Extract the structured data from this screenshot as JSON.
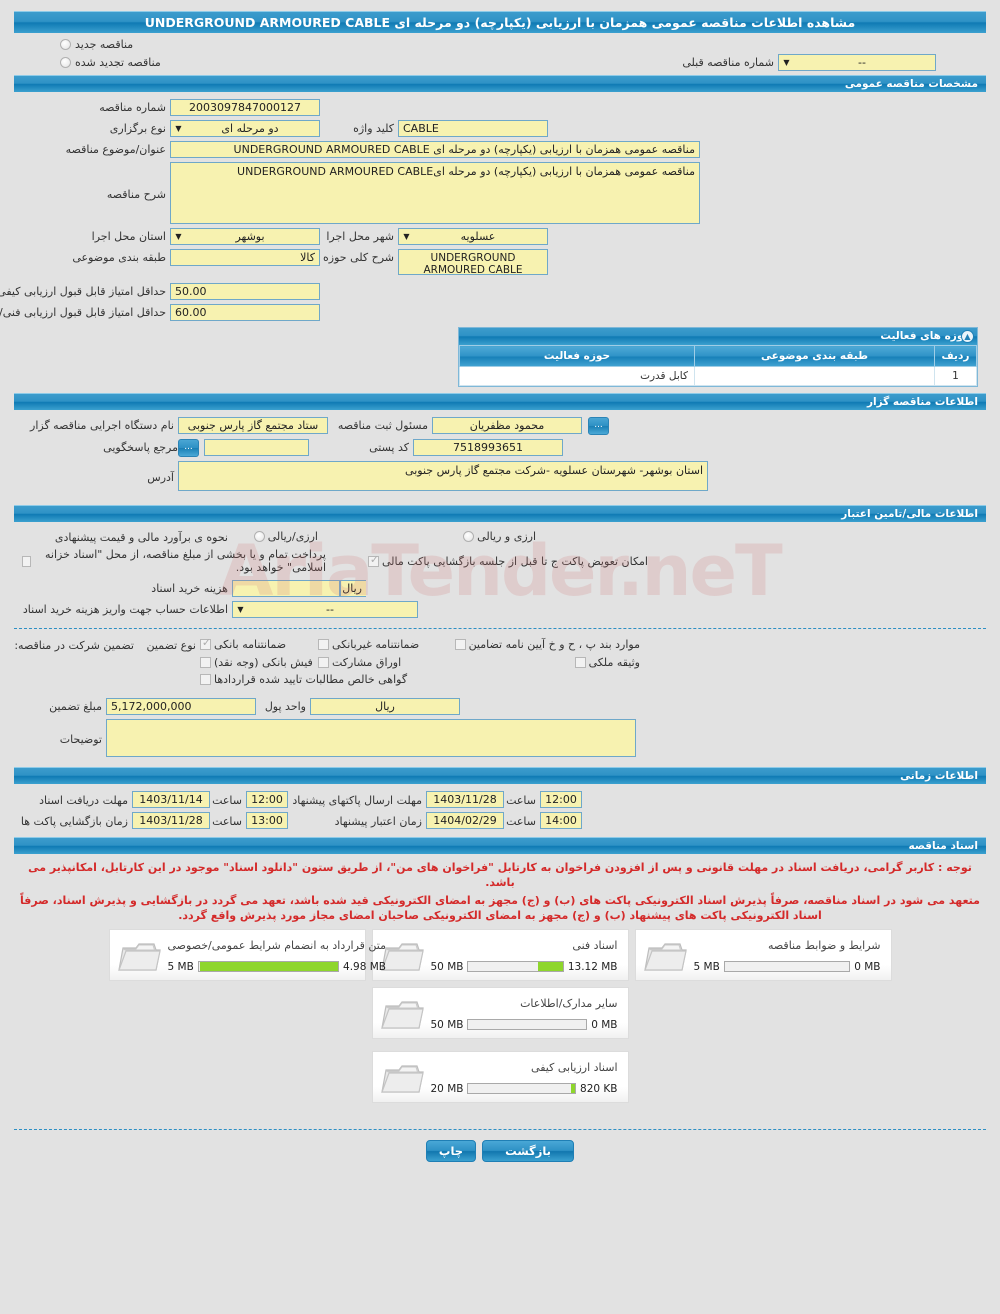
{
  "page": {
    "title": "مشاهده اطلاعات مناقصه عمومی همزمان با ارزیابی (یکپارچه) دو مرحله ای UNDERGROUND ARMOURED CABLE"
  },
  "top": {
    "new_tender_label": "مناقصه جدید",
    "renewed_tender_label": "مناقصه تجدید شده",
    "prev_tender_number_label": "شماره مناقصه قبلی",
    "prev_tender_number_value": "--"
  },
  "general": {
    "section_title": "مشخصات مناقصه عمومی",
    "tender_no_label": "شماره مناقصه",
    "tender_no_value": "2003097847000127",
    "holding_type_label": "نوع برگزاری",
    "holding_type_value": "دو مرحله ای",
    "keyword_label": "کلید واژه",
    "keyword_value": "CABLE",
    "subject_label": "عنوان/موضوع مناقصه",
    "subject_value": "مناقصه عمومی همزمان با ارزیابی (یکپارچه) دو مرحله ای UNDERGROUND ARMOURED CABLE",
    "description_label": "شرح مناقصه",
    "description_value": "مناقصه عمومی همزمان با ارزیابی (یکپارچه) دو مرحله ایUNDERGROUND ARMOURED CABLE",
    "province_label": "استان محل اجرا",
    "province_value": "بوشهر",
    "city_label": "شهر محل اجرا",
    "city_value": "عسلویه",
    "category_label": "طبقه بندی موضوعی",
    "category_value": "کالا",
    "activity_desc_label": "شرح کلی حوزه فعالیت",
    "activity_desc_value": "UNDERGROUND ARMOURED CABLE",
    "min_quality_label": "حداقل امتیاز قابل قبول ارزیابی کیفی",
    "min_quality_value": "50.00",
    "min_tech_label": "حداقل امتیاز قابل قبول ارزیابی فنی/بازرگانی",
    "min_tech_value": "60.00"
  },
  "activity_table": {
    "section_title": "حوزه های فعالیت",
    "columns": [
      "ردیف",
      "طبقه بندی موضوعی",
      "حوزه فعالیت"
    ],
    "rows": [
      {
        "no": "1",
        "category": "",
        "area": "کابل قدرت"
      }
    ]
  },
  "organizer": {
    "section_title": "اطلاعات مناقصه گزار",
    "agency_label": "نام دستگاه اجرایی مناقصه گزار",
    "agency_value": "ستاد مجتمع گاز پارس جنوبی",
    "registrar_label": "مسئول ثبت مناقصه",
    "registrar_value": "محمود مظفریان",
    "contact_label": "مرجع پاسخگویی",
    "contact_value": "",
    "postal_code_label": "کد پستی",
    "postal_code_value": "7518993651",
    "address_label": "آدرس",
    "address_value": "استان بوشهر- شهرستان عسلویه -شرکت مجتمع گاز پارس جنوبی",
    "dots_label": "..."
  },
  "financial": {
    "section_title": "اطلاعات مالی/تامین اعتبار",
    "estimate_label": "نحوه ی برآورد مالی و قیمت پیشنهادی",
    "option_rial": "ارزی/ریالی",
    "option_rial_and_currency": "ارزی و ریالی",
    "islamic_bond_text": "پرداخت تمام و یا بخشی از مبلغ مناقصه، از محل \"اسناد خزانه اسلامی\" خواهد بود.",
    "swap_envelope_text": "امکان تعویض پاکت ج تا قبل از جلسه بازگشایی پاکت مالی",
    "swap_envelope_checked": true,
    "doc_cost_label": "هزینه خرید اسناد",
    "doc_cost_value": "",
    "doc_cost_currency": "ریال",
    "account_info_label": "اطلاعات حساب جهت واریز هزینه خرید اسناد",
    "account_info_value": "--"
  },
  "guarantee": {
    "participation_label": "تضمین شرکت در مناقصه:",
    "type_label": "نوع تضمین",
    "options": [
      {
        "label": "ضمانتنامه بانکی",
        "checked": true
      },
      {
        "label": "ضمانتنامه غیربانکی",
        "checked": false
      },
      {
        "label": "موارد بند پ ، ح و خ آیین نامه تضامین",
        "checked": false
      },
      {
        "label": "فیش بانکی (وجه نقد)",
        "checked": false
      },
      {
        "label": "اوراق مشارکت",
        "checked": false
      },
      {
        "label": "وثیقه ملکی",
        "checked": false
      },
      {
        "label": "گواهی خالص مطالبات تایید شده قراردادها",
        "checked": false
      }
    ],
    "amount_label": "مبلغ تضمین",
    "amount_value": "5,172,000,000",
    "currency_unit_label": "واحد پول",
    "currency_unit_value": "ریال",
    "notes_label": "توضیحات",
    "notes_value": ""
  },
  "timing": {
    "section_title": "اطلاعات زمانی",
    "hour_label": "ساعت",
    "receive_docs_label": "مهلت دریافت اسناد",
    "receive_docs_date": "1403/11/14",
    "receive_docs_time": "12:00",
    "open_envelopes_label": "زمان بازگشایی پاکت ها",
    "open_envelopes_date": "1403/11/28",
    "open_envelopes_time": "13:00",
    "submit_docs_label": "مهلت ارسال پاکتهای پیشنهاد",
    "submit_docs_date": "1403/11/28",
    "submit_docs_time": "12:00",
    "validity_label": "زمان اعتبار پیشنهاد",
    "validity_date": "1404/02/29",
    "validity_time": "14:00"
  },
  "documents": {
    "section_title": "اسناد مناقصه",
    "note_line1": "توجه : کاربر گرامی، دریافت اسناد در مهلت قانونی و پس از افزودن فراخوان به کارتابل \"فراخوان های من\"، از طریق ستون \"دانلود اسناد\" موجود در این کارتابل، امکانپذیر می باشد.",
    "note_line2": "متعهد می شود در اسناد مناقصه، صرفاً پذیرش اسناد الکترونیکی پاکت های (ب) و (ج) مجهز به امضای الکترونیکی قید شده باشد، تعهد می گردد در بازگشایی و پذیرش اسناد، صرفاً اسناد الکترونیکی پاکت های پیشنهاد (ب) و (ج) مجهز به امضای الکترونیکی صاحبان امضای مجاز مورد پذیرش واقع گردد.",
    "files": [
      {
        "name": "شرایط و ضوابط مناقصه",
        "current": "0 MB",
        "max": "5 MB",
        "percent": 0
      },
      {
        "name": "اسناد فنی",
        "current": "13.12 MB",
        "max": "50 MB",
        "percent": 26
      },
      {
        "name": "متن قرارداد به انضمام شرایط عمومی/خصوصی",
        "current": "4.98 MB",
        "max": "5 MB",
        "percent": 99
      },
      {
        "name": "سایر مدارک/اطلاعات",
        "current": "0 MB",
        "max": "50 MB",
        "percent": 0
      },
      {
        "name": "اسناد ارزیابی کیفی",
        "current": "820 KB",
        "max": "20 MB",
        "percent": 4
      }
    ]
  },
  "footer": {
    "back_label": "بازگشت",
    "print_label": "چاپ"
  },
  "watermark": {
    "text": "AriaTender.neT"
  },
  "colors": {
    "header_blue": "#2f92c6",
    "field_yellow": "#f7f2b0",
    "field_border": "#6fa8c9",
    "note_red": "#d42a2a",
    "progress_green": "#8ed62c",
    "page_bg": "#e2e2e2"
  }
}
